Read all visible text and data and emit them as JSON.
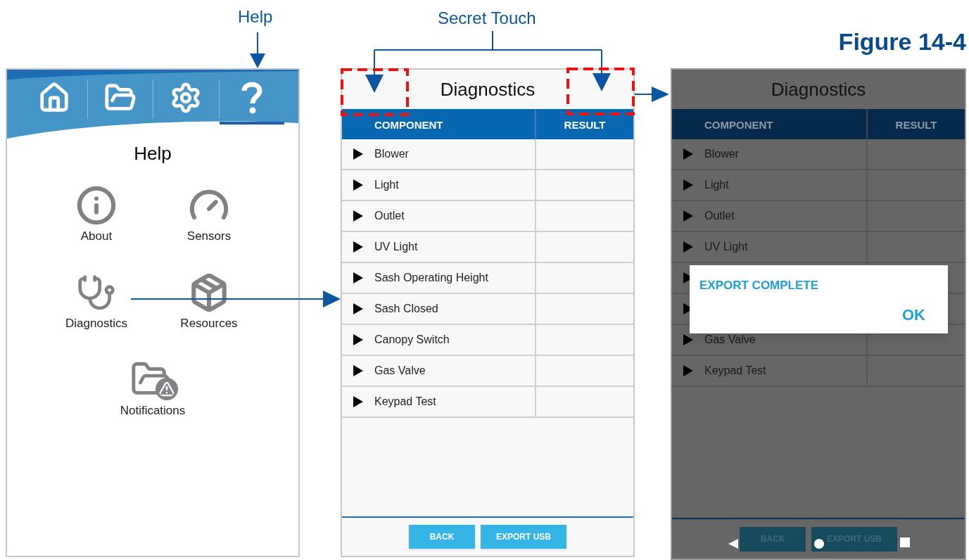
{
  "figure_title": "Figure 14-4",
  "callouts": [
    {
      "kind": "help",
      "label": "Help"
    },
    {
      "kind": "secret",
      "label": "Secret Touch"
    }
  ],
  "help_screen": {
    "nav": [
      {
        "kind": "home",
        "selected": false
      },
      {
        "kind": "folder",
        "selected": false
      },
      {
        "kind": "settings",
        "selected": false
      },
      {
        "kind": "help",
        "selected": true
      }
    ],
    "title": "Help",
    "items": [
      {
        "kind": "about",
        "label": "About"
      },
      {
        "kind": "sensors",
        "label": "Sensors"
      },
      {
        "kind": "diagnostics",
        "label": "Diagnostics"
      },
      {
        "kind": "resources",
        "label": "Resources"
      },
      {
        "kind": "notifications",
        "label": "Notifications"
      }
    ]
  },
  "diagnostics_screen": {
    "title": "Diagnostics",
    "columns": [
      "COMPONENT",
      "RESULT"
    ],
    "rows": [
      {
        "label": "Blower"
      },
      {
        "label": "Light"
      },
      {
        "label": "Outlet"
      },
      {
        "label": "UV Light"
      },
      {
        "label": "Sash Operating Height"
      },
      {
        "label": "Sash Closed"
      },
      {
        "label": "Canopy Switch"
      },
      {
        "label": "Gas Valve"
      },
      {
        "label": "Keypad Test"
      }
    ],
    "buttons": [
      "BACK",
      "EXPORT USB"
    ]
  },
  "export_screen": {
    "title": "Diagnostics",
    "columns": [
      "COMPONENT",
      "RESULT"
    ],
    "rows": [
      {
        "kind": "row",
        "label": "Blower"
      },
      {
        "kind": "row",
        "label": "Light"
      },
      {
        "kind": "row",
        "label": "Outlet"
      },
      {
        "kind": "row",
        "label": "UV Light"
      },
      {
        "kind": "covered"
      },
      {
        "kind": "covered"
      },
      {
        "kind": "row",
        "label": "Gas Valve"
      },
      {
        "kind": "row",
        "label": "Keypad Test"
      }
    ],
    "dialog": {
      "message": "EXPORT COMPLETE",
      "button": "OK"
    },
    "buttons": [
      "BACK",
      "EXPORT USB"
    ]
  }
}
